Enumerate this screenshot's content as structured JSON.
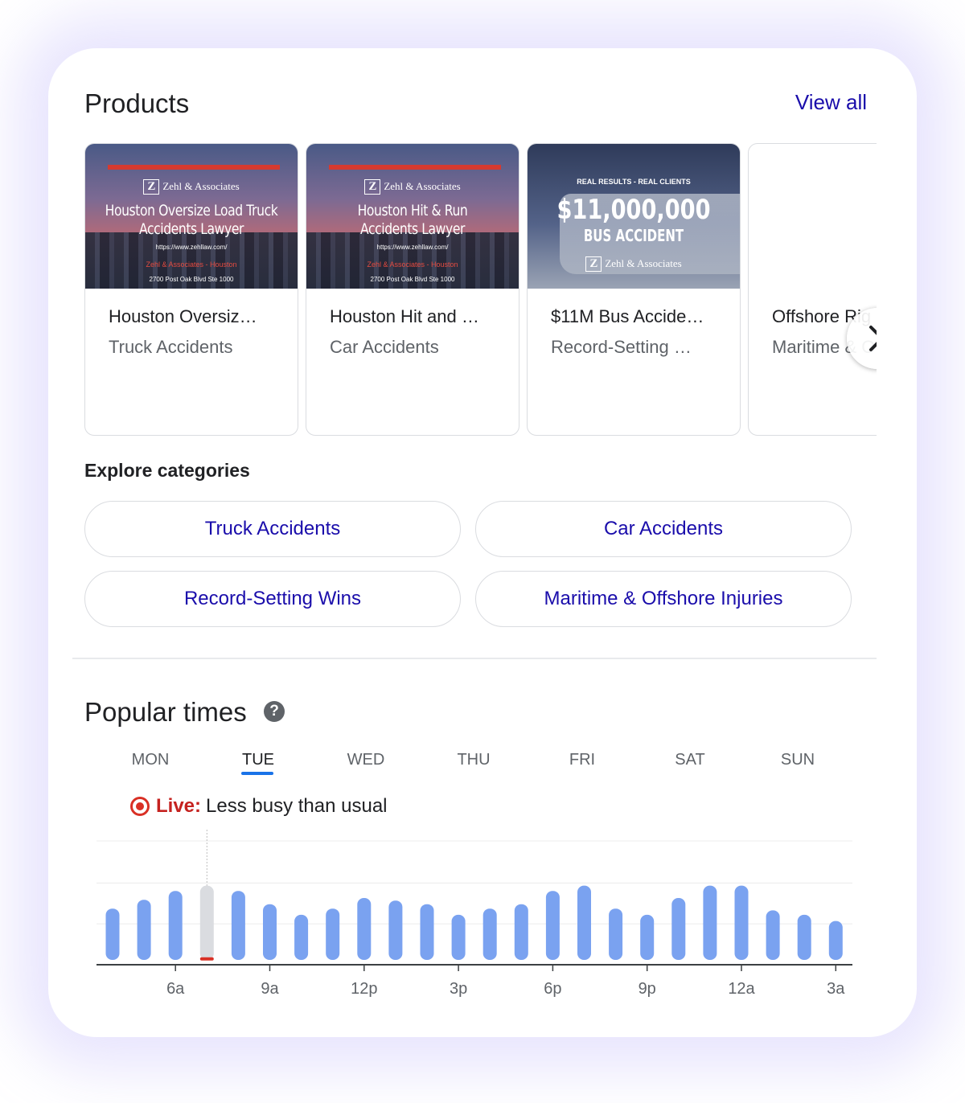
{
  "products": {
    "title": "Products",
    "view_all": "View all",
    "items": [
      {
        "image": {
          "logo_letter": "Z",
          "logo_text": "Zehl & Associates",
          "headline_line1": "Houston Oversize Load Truck",
          "headline_line2": "Accidents Lawyer",
          "url": "https://www.zehllaw.com/",
          "firm": "Zehl & Associates - Houston",
          "address": "2700 Post Oak Blvd Ste 1000"
        },
        "title": "Houston Oversiz…",
        "category": "Truck Accidents"
      },
      {
        "image": {
          "logo_letter": "Z",
          "logo_text": "Zehl & Associates",
          "headline_line1": "Houston Hit & Run",
          "headline_line2": "Accidents Lawyer",
          "url": "https://www.zehllaw.com/",
          "firm": "Zehl & Associates - Houston",
          "address": "2700 Post Oak Blvd Ste 1000"
        },
        "title": "Houston Hit and …",
        "category": "Car Accidents"
      },
      {
        "image": {
          "tagline": "REAL RESULTS - REAL CLIENTS",
          "amount": "$11,000,000",
          "subtitle": "BUS ACCIDENT",
          "logo_letter": "Z",
          "logo_text": "Zehl & Associates"
        },
        "title": "$11M Bus Accide…",
        "category": "Record-Setting …"
      },
      {
        "title": "Offshore Rig",
        "category": "Maritime & O"
      }
    ],
    "next_icon": "chevron-right-icon"
  },
  "explore": {
    "title": "Explore categories",
    "chips": [
      "Truck Accidents",
      "Car Accidents",
      "Record-Setting Wins",
      "Maritime & Offshore Injuries"
    ]
  },
  "popular_times": {
    "title": "Popular times",
    "help_icon": "question-circle-icon",
    "help_glyph": "?",
    "days": [
      "MON",
      "TUE",
      "WED",
      "THU",
      "FRI",
      "SAT",
      "SUN"
    ],
    "selected_day": "TUE",
    "live_label": "Live:",
    "live_text": "Less busy than usual",
    "colors": {
      "bar": "#7aa2f0",
      "live_bar": "#dadce0",
      "live_level": "#d93025",
      "accent": "#1a73e8"
    }
  },
  "chart_data": {
    "type": "bar",
    "x_tick_labels": [
      "6a",
      "9a",
      "12p",
      "3p",
      "6p",
      "9p",
      "12a",
      "3a"
    ],
    "hours": [
      "4a",
      "5a",
      "6a",
      "7a",
      "8a",
      "9a",
      "10a",
      "11a",
      "12p",
      "1p",
      "2p",
      "3p",
      "4p",
      "5p",
      "6p",
      "7p",
      "8p",
      "9p",
      "10p",
      "11p",
      "12a",
      "1a",
      "2a",
      "3a"
    ],
    "values": [
      58,
      68,
      78,
      84,
      78,
      63,
      51,
      58,
      70,
      67,
      63,
      51,
      58,
      63,
      78,
      84,
      58,
      51,
      70,
      84,
      84,
      56,
      51,
      44
    ],
    "live_hour": "7a",
    "live_value": 3,
    "ylim": [
      0,
      140
    ],
    "grid": true
  }
}
